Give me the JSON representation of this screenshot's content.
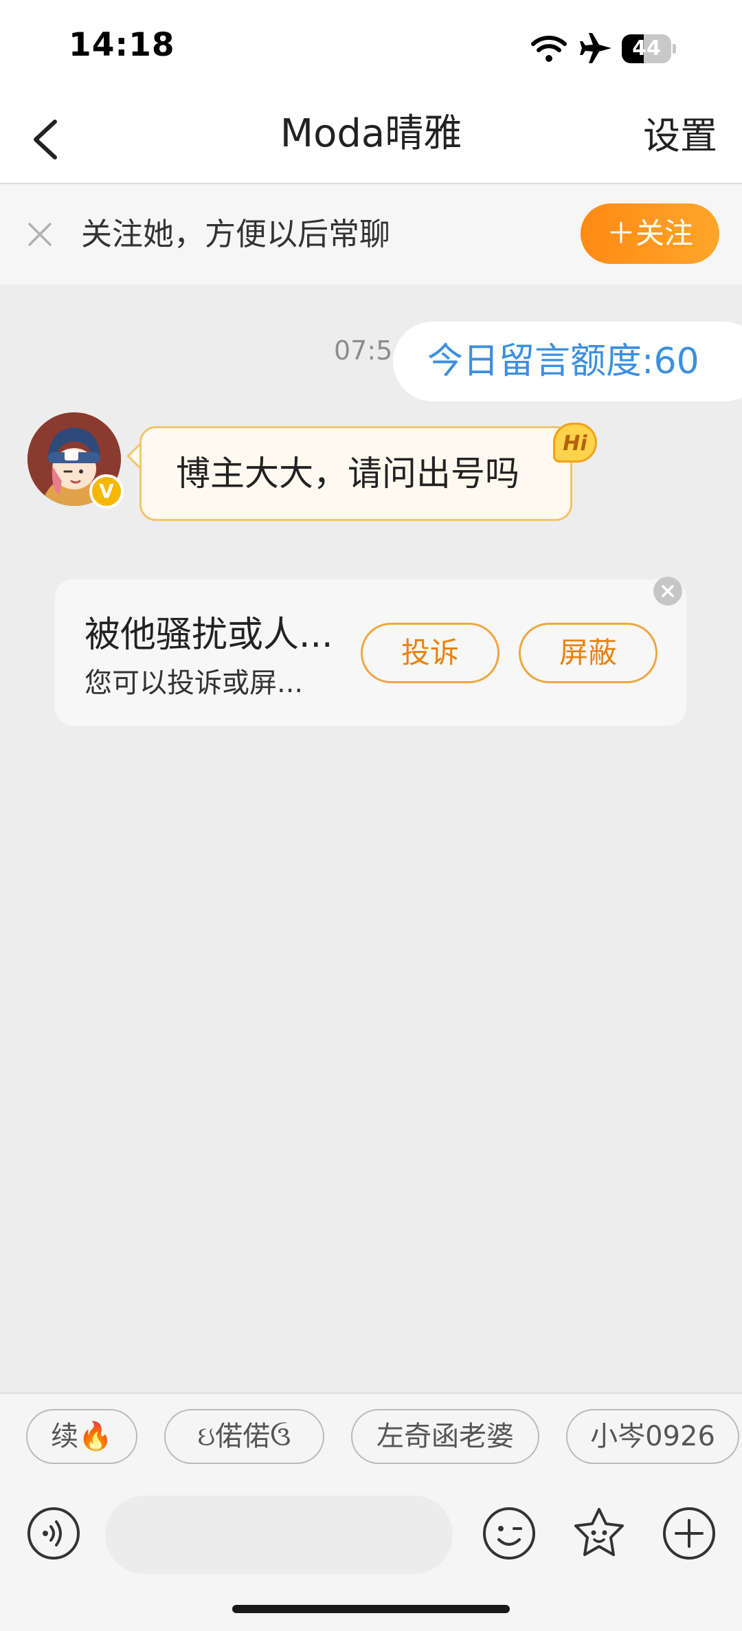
{
  "status_bar": {
    "time": "14:18",
    "battery": "44",
    "battery_level": 0.44
  },
  "nav": {
    "title": "Moda晴雅",
    "settings_label": "设置"
  },
  "follow_banner": {
    "prompt": "关注她，方便以后常聊",
    "follow_label": "＋关注"
  },
  "chat": {
    "time": "07:5",
    "quota_label": "今日留言额度:60",
    "message": {
      "text": "博主大大，请问出号吗",
      "badge": "Hi",
      "verified_mark": "V"
    }
  },
  "report_card": {
    "title": "被他骚扰或人...",
    "subtitle": "您可以投诉或屏...",
    "report_label": "投诉",
    "block_label": "屏蔽"
  },
  "chips": [
    {
      "label": "续🔥"
    },
    {
      "label": "ઇ偌偌ઉ"
    },
    {
      "label": "左奇函老婆"
    },
    {
      "label": "小岑0926"
    }
  ],
  "input": {
    "placeholder": ""
  },
  "colors": {
    "accent_orange": "#ff8a14",
    "quota_blue": "#3c8fe0",
    "background": "#ededed"
  }
}
